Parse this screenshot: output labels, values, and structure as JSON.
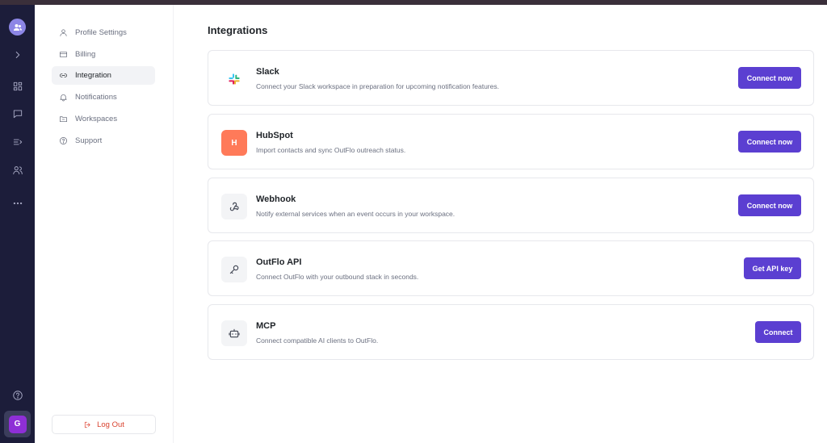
{
  "rail": {
    "icons": [
      "users-icon",
      "chevron-right-icon",
      "grid-icon",
      "chat-icon",
      "sequence-icon",
      "people-icon",
      "more-icon",
      "help-icon"
    ],
    "user_initial": "G"
  },
  "settings_menu": {
    "items": [
      {
        "label": "Profile Settings",
        "icon": "user-icon"
      },
      {
        "label": "Billing",
        "icon": "card-icon"
      },
      {
        "label": "Integration",
        "icon": "link-icon",
        "active": true
      },
      {
        "label": "Notifications",
        "icon": "bell-icon"
      },
      {
        "label": "Workspaces",
        "icon": "folder-icon"
      },
      {
        "label": "Support",
        "icon": "help-icon"
      }
    ],
    "logout_label": "Log Out"
  },
  "main": {
    "title": "Integrations",
    "integrations": [
      {
        "name": "Slack",
        "description": "Connect your Slack workspace in preparation for upcoming notification features.",
        "button": "Connect now",
        "icon": "slack-logo-icon"
      },
      {
        "name": "HubSpot",
        "description": "Import contacts and sync OutFlo outreach status.",
        "button": "Connect now",
        "icon": "hubspot-logo-icon",
        "icon_letter": "H"
      },
      {
        "name": "Webhook",
        "description": "Notify external services when an event occurs in your workspace.",
        "button": "Connect now",
        "icon": "webhook-icon"
      },
      {
        "name": "OutFlo API",
        "description": "Connect OutFlo with your outbound stack in seconds.",
        "button": "Get API key",
        "icon": "key-icon"
      },
      {
        "name": "MCP",
        "description": "Connect compatible AI clients to OutFlo.",
        "button": "Connect",
        "icon": "bot-icon"
      }
    ]
  },
  "colors": {
    "rail_bg": "#1c1d3a",
    "accent": "#5b3fd1",
    "logout": "#d9432f",
    "hubspot": "#ff7a59",
    "user_badge": "#8e2fd6"
  }
}
